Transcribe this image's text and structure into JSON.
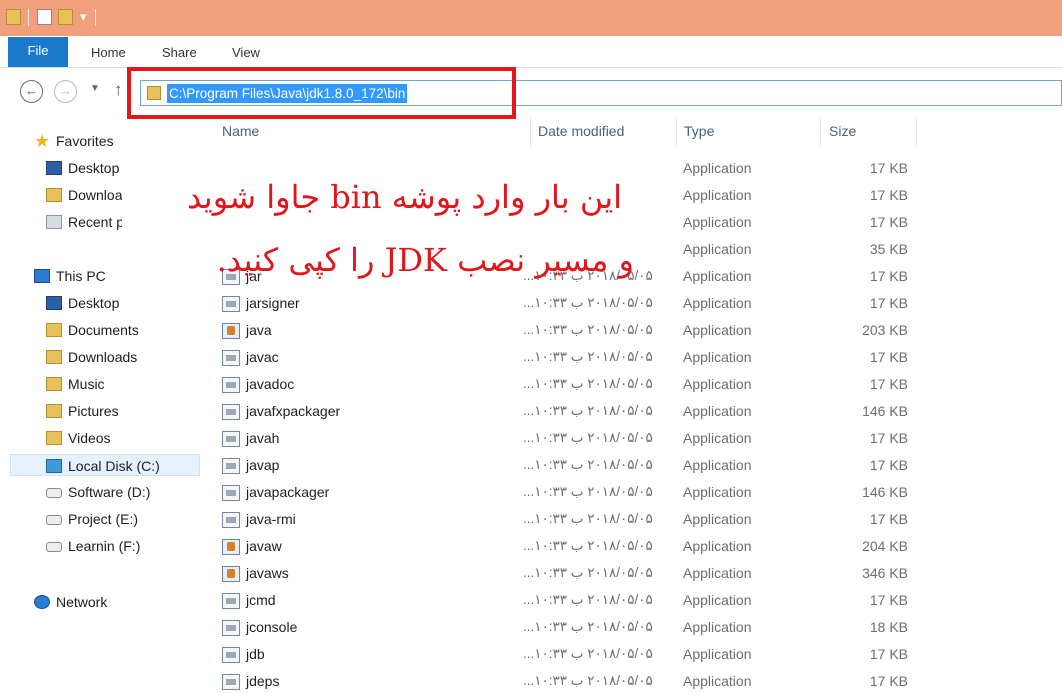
{
  "ribbon": {
    "tabs": [
      "File",
      "Home",
      "Share",
      "View"
    ]
  },
  "address": {
    "path": "C:\\Program Files\\Java\\jdk1.8.0_172\\bin"
  },
  "navpane": {
    "favorites": "Favorites",
    "favorites_items": [
      "Desktop",
      "Downloa",
      "Recent p"
    ],
    "this_pc": "This PC",
    "pc_items": [
      "Desktop",
      "Documents",
      "Downloads",
      "Music",
      "Pictures",
      "Videos",
      "Local Disk (C:)",
      "Software (D:)",
      "Project (E:)",
      "Learnin (F:)"
    ],
    "network": "Network"
  },
  "columns": {
    "name": "Name",
    "date": "Date modified",
    "type": "Type",
    "size": "Size"
  },
  "files": [
    {
      "name": "",
      "date": "",
      "type": "Application",
      "size": "17 KB"
    },
    {
      "name": "",
      "date": "",
      "type": "Application",
      "size": "17 KB"
    },
    {
      "name": "",
      "date": "",
      "type": "Application",
      "size": "17 KB"
    },
    {
      "name": "",
      "date": "",
      "type": "Application",
      "size": "35 KB"
    },
    {
      "name": "jar",
      "date": "۲۰۱۸/۰۵/۰۵ ب ۱۰:۳۳...",
      "type": "Application",
      "size": "17 KB"
    },
    {
      "name": "jarsigner",
      "date": "۲۰۱۸/۰۵/۰۵ ب ۱۰:۳۳...",
      "type": "Application",
      "size": "17 KB"
    },
    {
      "name": "java",
      "date": "۲۰۱۸/۰۵/۰۵ ب ۱۰:۳۳...",
      "type": "Application",
      "size": "203 KB"
    },
    {
      "name": "javac",
      "date": "۲۰۱۸/۰۵/۰۵ ب ۱۰:۳۳...",
      "type": "Application",
      "size": "17 KB"
    },
    {
      "name": "javadoc",
      "date": "۲۰۱۸/۰۵/۰۵ ب ۱۰:۳۳...",
      "type": "Application",
      "size": "17 KB"
    },
    {
      "name": "javafxpackager",
      "date": "۲۰۱۸/۰۵/۰۵ ب ۱۰:۳۳...",
      "type": "Application",
      "size": "146 KB"
    },
    {
      "name": "javah",
      "date": "۲۰۱۸/۰۵/۰۵ ب ۱۰:۳۳...",
      "type": "Application",
      "size": "17 KB"
    },
    {
      "name": "javap",
      "date": "۲۰۱۸/۰۵/۰۵ ب ۱۰:۳۳...",
      "type": "Application",
      "size": "17 KB"
    },
    {
      "name": "javapackager",
      "date": "۲۰۱۸/۰۵/۰۵ ب ۱۰:۳۳...",
      "type": "Application",
      "size": "146 KB"
    },
    {
      "name": "java-rmi",
      "date": "۲۰۱۸/۰۵/۰۵ ب ۱۰:۳۳...",
      "type": "Application",
      "size": "17 KB"
    },
    {
      "name": "javaw",
      "date": "۲۰۱۸/۰۵/۰۵ ب ۱۰:۳۳...",
      "type": "Application",
      "size": "204 KB"
    },
    {
      "name": "javaws",
      "date": "۲۰۱۸/۰۵/۰۵ ب ۱۰:۳۳...",
      "type": "Application",
      "size": "346 KB"
    },
    {
      "name": "jcmd",
      "date": "۲۰۱۸/۰۵/۰۵ ب ۱۰:۳۳...",
      "type": "Application",
      "size": "17 KB"
    },
    {
      "name": "jconsole",
      "date": "۲۰۱۸/۰۵/۰۵ ب ۱۰:۳۳...",
      "type": "Application",
      "size": "18 KB"
    },
    {
      "name": "jdb",
      "date": "۲۰۱۸/۰۵/۰۵ ب ۱۰:۳۳...",
      "type": "Application",
      "size": "17 KB"
    },
    {
      "name": "jdeps",
      "date": "۲۰۱۸/۰۵/۰۵ ب ۱۰:۳۳...",
      "type": "Application",
      "size": "17 KB"
    }
  ],
  "annotation": {
    "line1": "این بار وارد پوشه bin جاوا شوید",
    "line2": "و مسیر نصب JDK را کپی کنید."
  },
  "icons": {
    "back": "back-arrow-icon",
    "forward": "forward-arrow-icon",
    "up": "up-arrow-icon"
  },
  "colors": {
    "titlebar": "#f29f7e",
    "file_tab": "#1979ca",
    "selection": "#3399ff",
    "annotation": "#e0161d"
  }
}
